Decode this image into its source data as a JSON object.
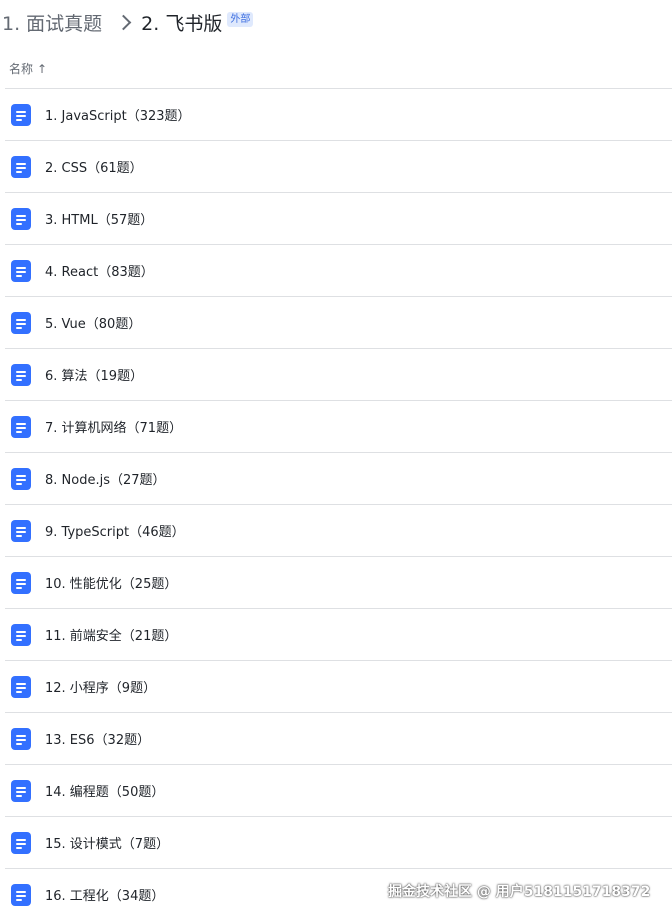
{
  "breadcrumb": {
    "parent": "1. 面试真题",
    "current": "2. 飞书版",
    "badge": "外部"
  },
  "header": {
    "name_col": "名称",
    "sort_icon": "arrow-up-icon"
  },
  "items": [
    {
      "label": "1. JavaScript（323题）",
      "icon": "doc-icon"
    },
    {
      "label": "2. CSS（61题）",
      "icon": "doc-icon"
    },
    {
      "label": "3. HTML（57题）",
      "icon": "doc-icon"
    },
    {
      "label": "4. React（83题）",
      "icon": "doc-icon"
    },
    {
      "label": "5. Vue（80题）",
      "icon": "doc-icon"
    },
    {
      "label": "6. 算法（19题）",
      "icon": "doc-icon"
    },
    {
      "label": "7. 计算机网络（71题）",
      "icon": "doc-icon"
    },
    {
      "label": "8. Node.js（27题）",
      "icon": "doc-icon"
    },
    {
      "label": "9. TypeScript（46题）",
      "icon": "doc-icon"
    },
    {
      "label": "10. 性能优化（25题）",
      "icon": "doc-icon"
    },
    {
      "label": "11. 前端安全（21题）",
      "icon": "doc-icon"
    },
    {
      "label": "12. 小程序（9题）",
      "icon": "doc-icon"
    },
    {
      "label": "13. ES6（32题）",
      "icon": "doc-icon"
    },
    {
      "label": "14. 编程题（50题）",
      "icon": "doc-icon"
    },
    {
      "label": "15. 设计模式（7题）",
      "icon": "doc-icon"
    },
    {
      "label": "16. 工程化（34题）",
      "icon": "doc-icon"
    }
  ],
  "colors": {
    "icon": "#3370ff",
    "divider": "#dee0e3",
    "text": "#1f2329",
    "muted": "#646a73"
  },
  "watermark": "掘金技术社区 @ 用户5181151718372"
}
